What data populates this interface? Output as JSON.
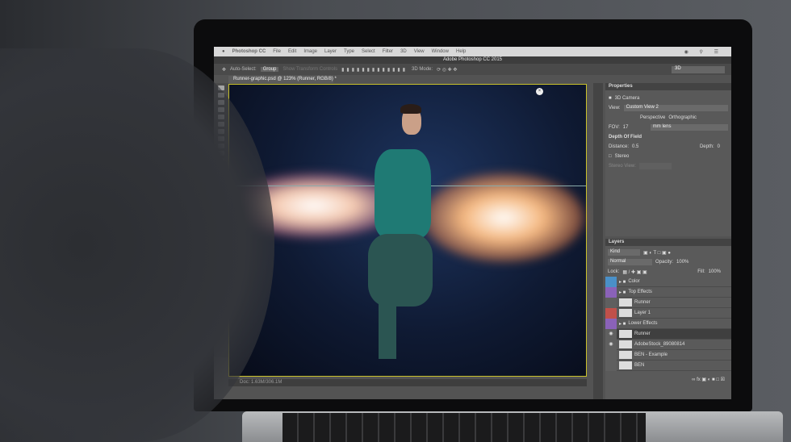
{
  "menubar": {
    "app": "Photoshop CC",
    "items": [
      "File",
      "Edit",
      "Image",
      "Layer",
      "Type",
      "Select",
      "Filter",
      "3D",
      "View",
      "Window",
      "Help"
    ]
  },
  "window_title": "Adobe Photoshop CC 2015",
  "options": {
    "auto_select": "Auto-Select:",
    "group": "Group",
    "transform": "Show Transform Controls",
    "mode_3d": "3D Mode:",
    "workspace": "3D"
  },
  "document_tab": "Runner-graphic.psd @ 123% (Runner, RGB/8) *",
  "status": "Doc: 1.63M/306.1M",
  "properties": {
    "title": "Properties",
    "type": "3D Camera",
    "view_label": "View:",
    "view_value": "Custom View 2",
    "perspective": "Perspective",
    "orthographic": "Orthographic",
    "fov_label": "FOV:",
    "fov_value": "17",
    "fov_unit": "mm lens",
    "dof": "Depth Of Field",
    "distance_label": "Distance:",
    "distance_value": "0.5",
    "depth_label": "Depth:",
    "depth_value": "0",
    "stereo": "Stereo",
    "stereo_view": "Stereo View:"
  },
  "layers": {
    "title": "Layers",
    "filter": "Kind",
    "blend": "Normal",
    "opacity_label": "Opacity:",
    "opacity": "100%",
    "lock_label": "Lock:",
    "fill_label": "Fill:",
    "fill": "100%",
    "items": [
      {
        "name": "Color",
        "color": "#4a90c8",
        "group": true
      },
      {
        "name": "Top Effects",
        "color": "#8a62b8",
        "group": true
      },
      {
        "name": "Runner",
        "color": "",
        "group": false
      },
      {
        "name": "Layer 1",
        "color": "#c0504a",
        "group": false
      },
      {
        "name": "Lower Effects",
        "color": "#8a62b8",
        "group": true
      },
      {
        "name": "Runner",
        "color": "",
        "group": false,
        "selected": true,
        "visible": true
      },
      {
        "name": "AdobeStock_89080814",
        "color": "",
        "group": false,
        "visible": true
      },
      {
        "name": "BEN - Example",
        "color": "",
        "group": false
      },
      {
        "name": "BEN",
        "color": "",
        "group": false
      }
    ]
  }
}
